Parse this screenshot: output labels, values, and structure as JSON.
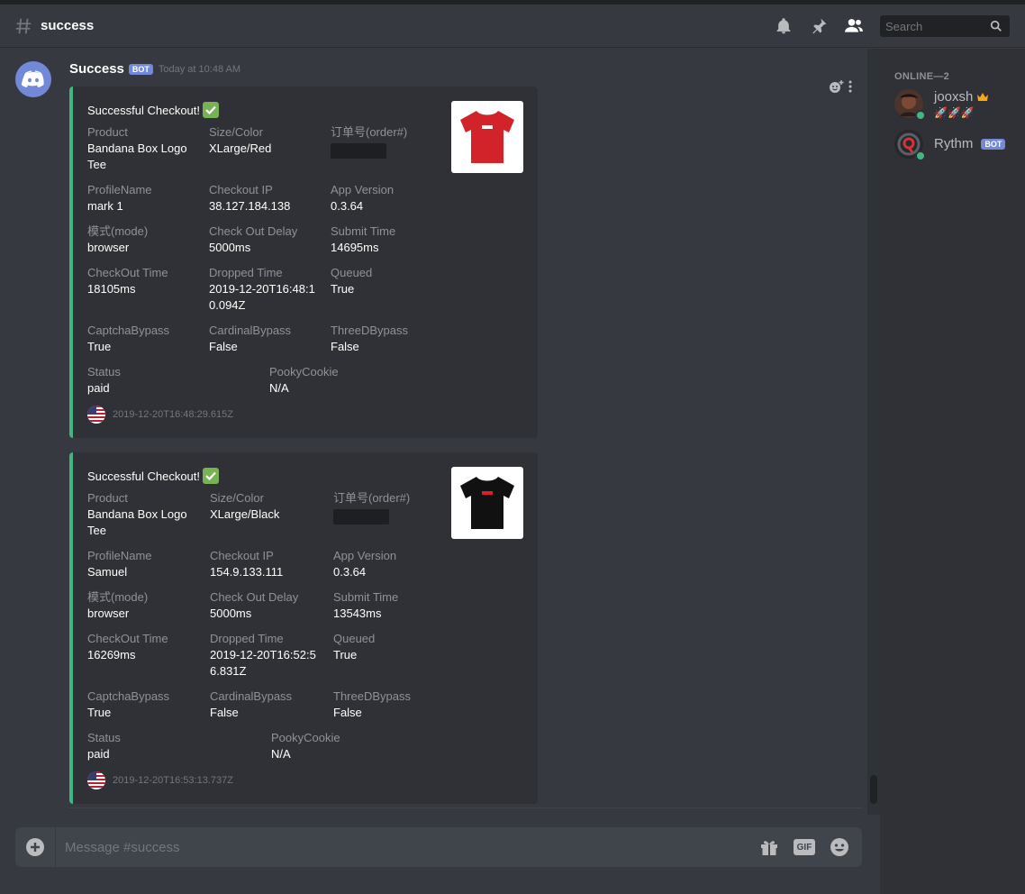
{
  "header": {
    "channel_name": "success",
    "search_placeholder": "Search"
  },
  "online_header": "ONLINE—2",
  "members": [
    {
      "name": "jooxsh",
      "status_text": "🚀🚀🚀",
      "badge": "crown"
    },
    {
      "name": "Rythm",
      "bot_tag": "BOT"
    }
  ],
  "message": {
    "author": "Success",
    "bot_tag": "BOT",
    "timestamp": "Today at 10:48 AM"
  },
  "embeds": [
    {
      "title": "Successful Checkout!",
      "shirt_color": "#d2232a",
      "fields": [
        {
          "name": "Product",
          "value": "Bandana Box Logo Tee"
        },
        {
          "name": "Size/Color",
          "value": "XLarge/Red"
        },
        {
          "name": "订单号(order#)",
          "value": ""
        },
        {
          "name": "ProfileName",
          "value": "mark 1"
        },
        {
          "name": "Checkout IP",
          "value": "38.127.184.138"
        },
        {
          "name": "App Version",
          "value": "0.3.64"
        },
        {
          "name": "模式(mode)",
          "value": "browser"
        },
        {
          "name": "Check Out Delay",
          "value": "5000ms"
        },
        {
          "name": "Submit Time",
          "value": "14695ms"
        },
        {
          "name": "CheckOut Time",
          "value": "18105ms"
        },
        {
          "name": "Dropped Time",
          "value": "2019-12-20T16:48:10.094Z"
        },
        {
          "name": "Queued",
          "value": "True"
        },
        {
          "name": "CaptchaBypass",
          "value": "True"
        },
        {
          "name": "CardinalBypass",
          "value": "False"
        },
        {
          "name": "ThreeDBypass",
          "value": "False"
        },
        {
          "name": "Status",
          "value": "paid"
        },
        {
          "name": "PookyCookie",
          "value": "N/A"
        }
      ],
      "footer": "2019-12-20T16:48:29.615Z"
    },
    {
      "title": "Successful Checkout!",
      "shirt_color": "#111111",
      "fields": [
        {
          "name": "Product",
          "value": "Bandana Box Logo Tee"
        },
        {
          "name": "Size/Color",
          "value": "XLarge/Black"
        },
        {
          "name": "订单号(order#)",
          "value": ""
        },
        {
          "name": "ProfileName",
          "value": "Samuel"
        },
        {
          "name": "Checkout IP",
          "value": "154.9.133.111"
        },
        {
          "name": "App Version",
          "value": "0.3.64"
        },
        {
          "name": "模式(mode)",
          "value": "browser"
        },
        {
          "name": "Check Out Delay",
          "value": "5000ms"
        },
        {
          "name": "Submit Time",
          "value": "13543ms"
        },
        {
          "name": "CheckOut Time",
          "value": "16269ms"
        },
        {
          "name": "Dropped Time",
          "value": "2019-12-20T16:52:56.831Z"
        },
        {
          "name": "Queued",
          "value": "True"
        },
        {
          "name": "CaptchaBypass",
          "value": "True"
        },
        {
          "name": "CardinalBypass",
          "value": "False"
        },
        {
          "name": "ThreeDBypass",
          "value": "False"
        },
        {
          "name": "Status",
          "value": "paid"
        },
        {
          "name": "PookyCookie",
          "value": "N/A"
        }
      ],
      "footer": "2019-12-20T16:53:13.737Z"
    }
  ],
  "composer": {
    "placeholder": "Message #success",
    "gif_label": "GIF"
  }
}
